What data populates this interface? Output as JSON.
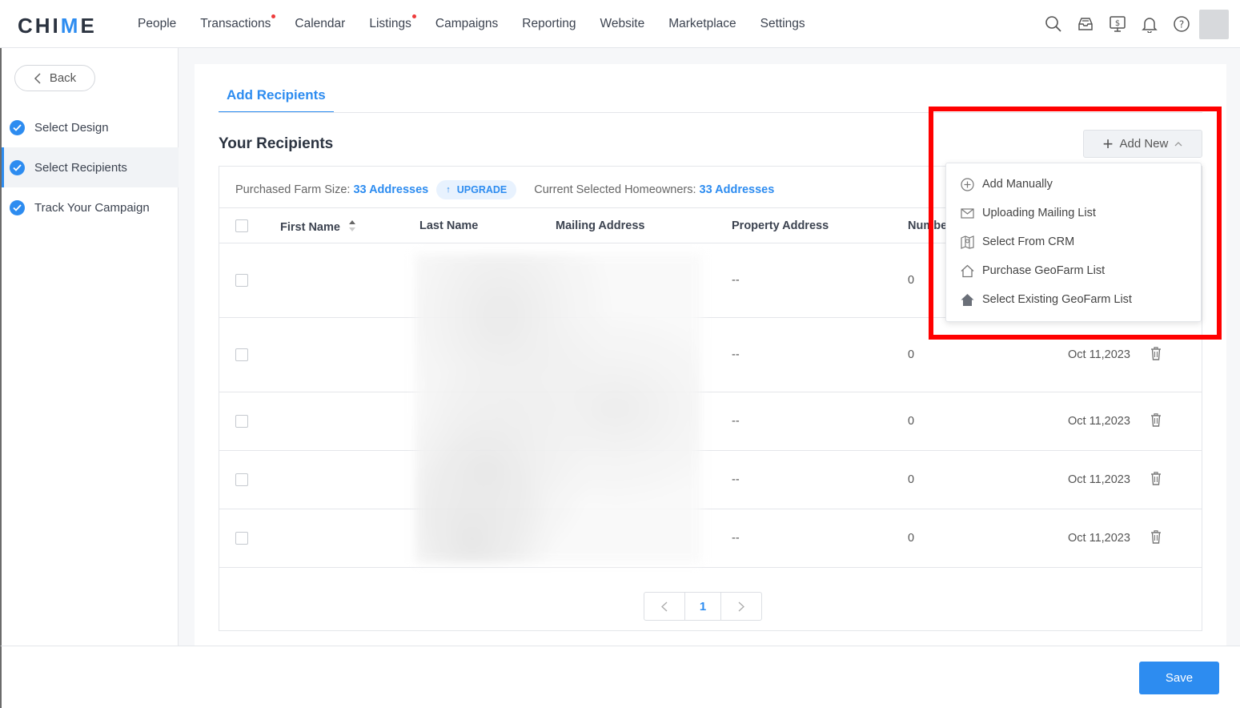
{
  "app": {
    "logo_text": "CHIME"
  },
  "nav": {
    "items": [
      {
        "label": "People"
      },
      {
        "label": "Transactions"
      },
      {
        "label": "Calendar"
      },
      {
        "label": "Listings"
      },
      {
        "label": "Campaigns"
      },
      {
        "label": "Reporting"
      },
      {
        "label": "Website"
      },
      {
        "label": "Marketplace"
      },
      {
        "label": "Settings"
      }
    ],
    "icons": [
      "search-icon",
      "inbox-icon",
      "dollar-screen-icon",
      "bell-icon",
      "help-icon",
      "avatar"
    ]
  },
  "sidebar": {
    "back_label": "Back",
    "steps": [
      {
        "label": "Select Design"
      },
      {
        "label": "Select Recipients"
      },
      {
        "label": "Track Your Campaign"
      }
    ]
  },
  "main": {
    "tab_label": "Add Recipients",
    "title": "Your Recipients",
    "add_new_label": "Add New",
    "summary": {
      "farm_size_label": "Purchased Farm Size:",
      "farm_size_value": "33 Addresses",
      "upgrade_label": "UPGRADE",
      "selected_label": "Current Selected Homeowners:",
      "selected_value": "33 Addresses"
    },
    "columns": [
      "First Name",
      "Last Name",
      "Mailing Address",
      "Property Address",
      "Numbe"
    ],
    "rows": [
      {
        "property": "--",
        "number": "0",
        "date": ""
      },
      {
        "property": "--",
        "number": "0",
        "date": "Oct 11,2023"
      },
      {
        "property": "--",
        "number": "0",
        "date": "Oct 11,2023"
      },
      {
        "property": "--",
        "number": "0",
        "date": "Oct 11,2023"
      },
      {
        "property": "--",
        "number": "0",
        "date": "Oct 11,2023"
      }
    ],
    "page": "1"
  },
  "dropdown": {
    "items": [
      {
        "label": "Add Manually",
        "icon": "plus-circle-icon"
      },
      {
        "label": "Uploading Mailing List",
        "icon": "envelope-icon"
      },
      {
        "label": "Select From CRM",
        "icon": "crm-map-icon"
      },
      {
        "label": "Purchase GeoFarm List",
        "icon": "house-outline-icon"
      },
      {
        "label": "Select Existing GeoFarm List",
        "icon": "house-filled-icon"
      }
    ]
  },
  "footer": {
    "save_label": "Save"
  },
  "colors": {
    "accent": "#2d8cf0",
    "highlight": "#ff0000",
    "notification_dot": "#ee3b3b"
  }
}
